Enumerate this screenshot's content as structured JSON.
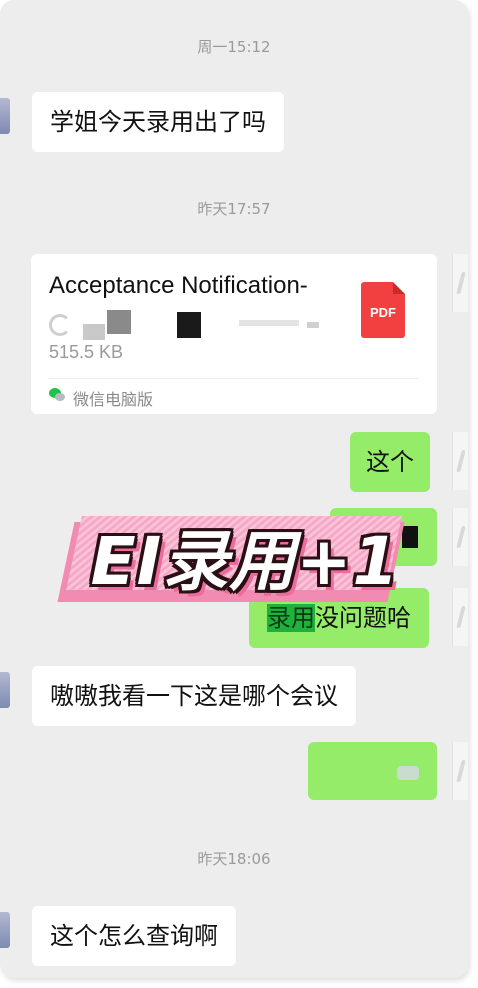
{
  "timestamps": {
    "t1": "周一15:12",
    "t2": "昨天17:57",
    "t3": "昨天18:06"
  },
  "messages": {
    "m1": "学姐今天录用出了吗",
    "m2": "这个",
    "m3_highlight": "录用",
    "m3_rest": "没问题哈",
    "m4": "嗷嗷我看一下这是哪个会议",
    "m5": "这个怎么查询啊"
  },
  "file": {
    "name": "Acceptance Notification-",
    "size": "515.5 KB",
    "type_label": "PDF",
    "source": "微信电脑版"
  },
  "overlay": {
    "text": "EI录用+1"
  },
  "colors": {
    "incoming_bubble": "#ffffff",
    "outgoing_bubble": "#95ec69",
    "pdf_red": "#f23f3f",
    "banner_pink": "#f28bb1"
  }
}
